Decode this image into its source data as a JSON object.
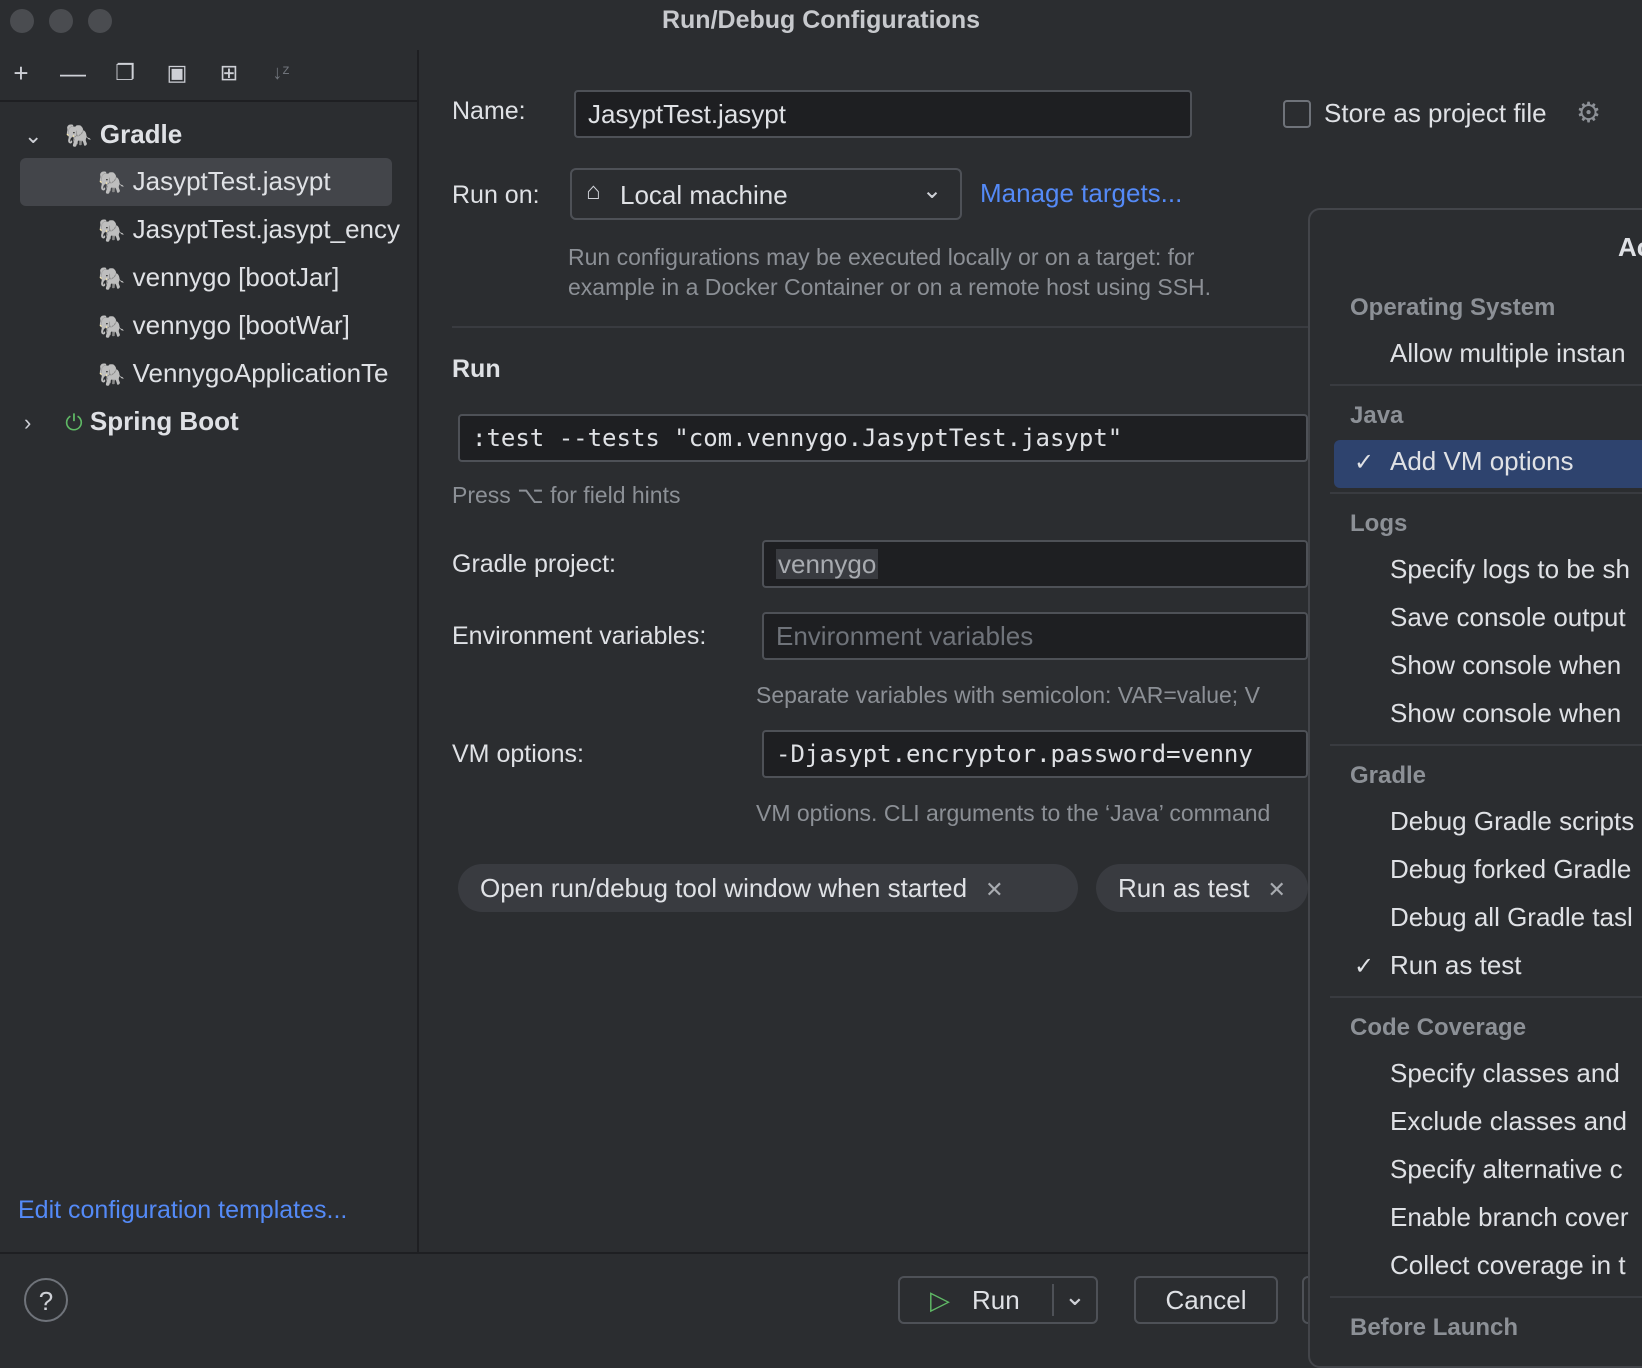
{
  "window": {
    "title": "Run/Debug Configurations"
  },
  "tree": {
    "groups": [
      {
        "label": "Gradle",
        "items": [
          "JasyptTest.jasypt",
          "JasyptTest.jasypt_ency",
          "vennygo [bootJar]",
          "vennygo [bootWar]",
          "VennygoApplicationTe"
        ]
      },
      {
        "label": "Spring Boot"
      }
    ],
    "edit_templates": "Edit configuration templates..."
  },
  "form": {
    "name_label": "Name:",
    "name_value": "JasyptTest.jasypt",
    "store_label": "Store as project file",
    "run_on_label": "Run on:",
    "run_on_value": "Local machine",
    "manage_targets": "Manage targets...",
    "run_on_hint_1": "Run configurations may be executed locally or on a target: for",
    "run_on_hint_2": "example in a Docker Container or on a remote host using SSH.",
    "run_section": "Run",
    "run_command": ":test --tests \"com.vennygo.JasyptTest.jasypt\"",
    "field_hints": "Press ⌥ for field hints",
    "gradle_project_label": "Gradle project:",
    "gradle_project_value": "vennygo",
    "env_label": "Environment variables:",
    "env_placeholder": "Environment variables",
    "env_hint": "Separate variables with semicolon: VAR=value; V",
    "vm_label": "VM options:",
    "vm_value": "-Djasypt.encryptor.password=venny",
    "vm_hint": "VM options. CLI arguments to the ‘Java’ command",
    "chips": [
      "Open run/debug tool window when started",
      "Run as test"
    ]
  },
  "buttons": {
    "help": "?",
    "run": "Run",
    "cancel": "Cancel"
  },
  "popup": {
    "title": "Ac",
    "groups": {
      "os": "Operating System",
      "java": "Java",
      "logs": "Logs",
      "gradle": "Gradle",
      "coverage": "Code Coverage",
      "before": "Before Launch"
    },
    "items": {
      "allow_multiple": "Allow multiple instan",
      "add_vm": "Add VM options",
      "specify_logs": "Specify logs to be sh",
      "save_console": "Save console output",
      "show_console_1": "Show console when",
      "show_console_2": "Show console when",
      "debug_scripts": "Debug Gradle scripts",
      "debug_forked": "Debug forked Gradle",
      "debug_all": "Debug all Gradle tasl",
      "run_as_test": "Run as test",
      "specify_classes": "Specify classes and",
      "exclude_classes": "Exclude classes and",
      "specify_alt": "Specify alternative c",
      "enable_branch": "Enable branch cover",
      "collect_coverage": "Collect coverage in t"
    },
    "check": "✓"
  }
}
